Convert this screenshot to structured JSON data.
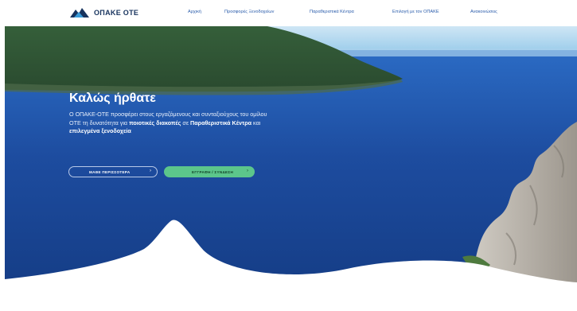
{
  "header": {
    "logo_text": "ΟΠΑΚΕ ΟΤΕ",
    "logo_icon": "mountain-logo-icon",
    "nav": [
      {
        "label": "Αρχική"
      },
      {
        "label": "Προσφορές Ξενοδοχείων"
      },
      {
        "label": "Παραθεριστικά Κέντρα"
      },
      {
        "label": "Επιλογή με τον ΟΠΑΚΕ"
      },
      {
        "label": "Ανακοινώσεις"
      }
    ]
  },
  "hero": {
    "title": "Καλώς ήρθατε",
    "text_part1": "Ο ΟΠΑΚΕ-ΟΤΕ προσφέρει στους εργαζόμενους και συνταξιούχους του ομίλου ΟΤΕ τη δυνατότητα για ",
    "text_bold1": "ποιοτικές διακοπές",
    "text_part2": " σε ",
    "text_bold2": "Παραθεριστικά Κέντρα",
    "text_part3": " και ",
    "text_bold3": "επιλεγμένα ξενοδοχεία",
    "btn_more": "ΜΑΘΕ ΠΕΡΙΣΣΟΤΕΡΑ",
    "btn_signup": "ΕΓΓΡΑΦΗ / ΣΥΝΔΕΣΗ",
    "arrow": "›"
  },
  "colors": {
    "nav_text": "#2a5cab",
    "logo_text": "#17335e",
    "sea": "#1f4fa0",
    "button_green": "#5cc68b"
  }
}
